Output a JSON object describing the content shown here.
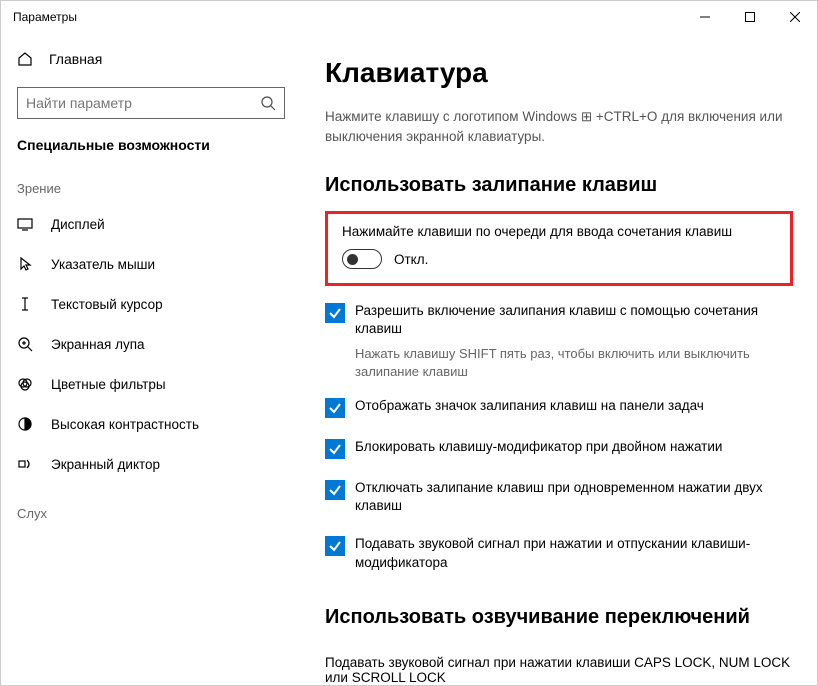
{
  "window": {
    "title": "Параметры"
  },
  "sidebar": {
    "home": "Главная",
    "search_placeholder": "Найти параметр",
    "section": "Специальные возможности",
    "group_vision": "Зрение",
    "group_hearing": "Слух",
    "items": [
      "Дисплей",
      "Указатель мыши",
      "Текстовый курсор",
      "Экранная лупа",
      "Цветные фильтры",
      "Высокая контрастность",
      "Экранный диктор"
    ]
  },
  "content": {
    "h1": "Клавиатура",
    "intro": "Нажмите клавишу с логотипом Windows ⊞ +CTRL+O для включения или выключения экранной клавиатуры.",
    "h2a": "Использовать залипание клавиш",
    "sticky_label": "Нажимайте клавиши по очереди для ввода сочетания клавиш",
    "toggle_state": "Откл.",
    "checks": [
      {
        "text": "Разрешить включение залипания клавиш с помощью сочетания клавиш",
        "sub": "Нажать клавишу SHIFT пять раз, чтобы включить или выключить залипание клавиш"
      },
      {
        "text": "Отображать значок залипания клавиш на панели задач"
      },
      {
        "text": "Блокировать клавишу-модификатор при двойном нажатии"
      },
      {
        "text": "Отключать залипание клавиш при одновременном нажатии двух клавиш"
      },
      {
        "text": "Подавать звуковой сигнал при нажатии и отпускании клавиши-модификатора"
      }
    ],
    "h2b": "Использовать озвучивание переключений",
    "switch_desc": "Подавать звуковой сигнал при нажатии клавиши CAPS LOCK, NUM LOCK или SCROLL LOCK"
  }
}
